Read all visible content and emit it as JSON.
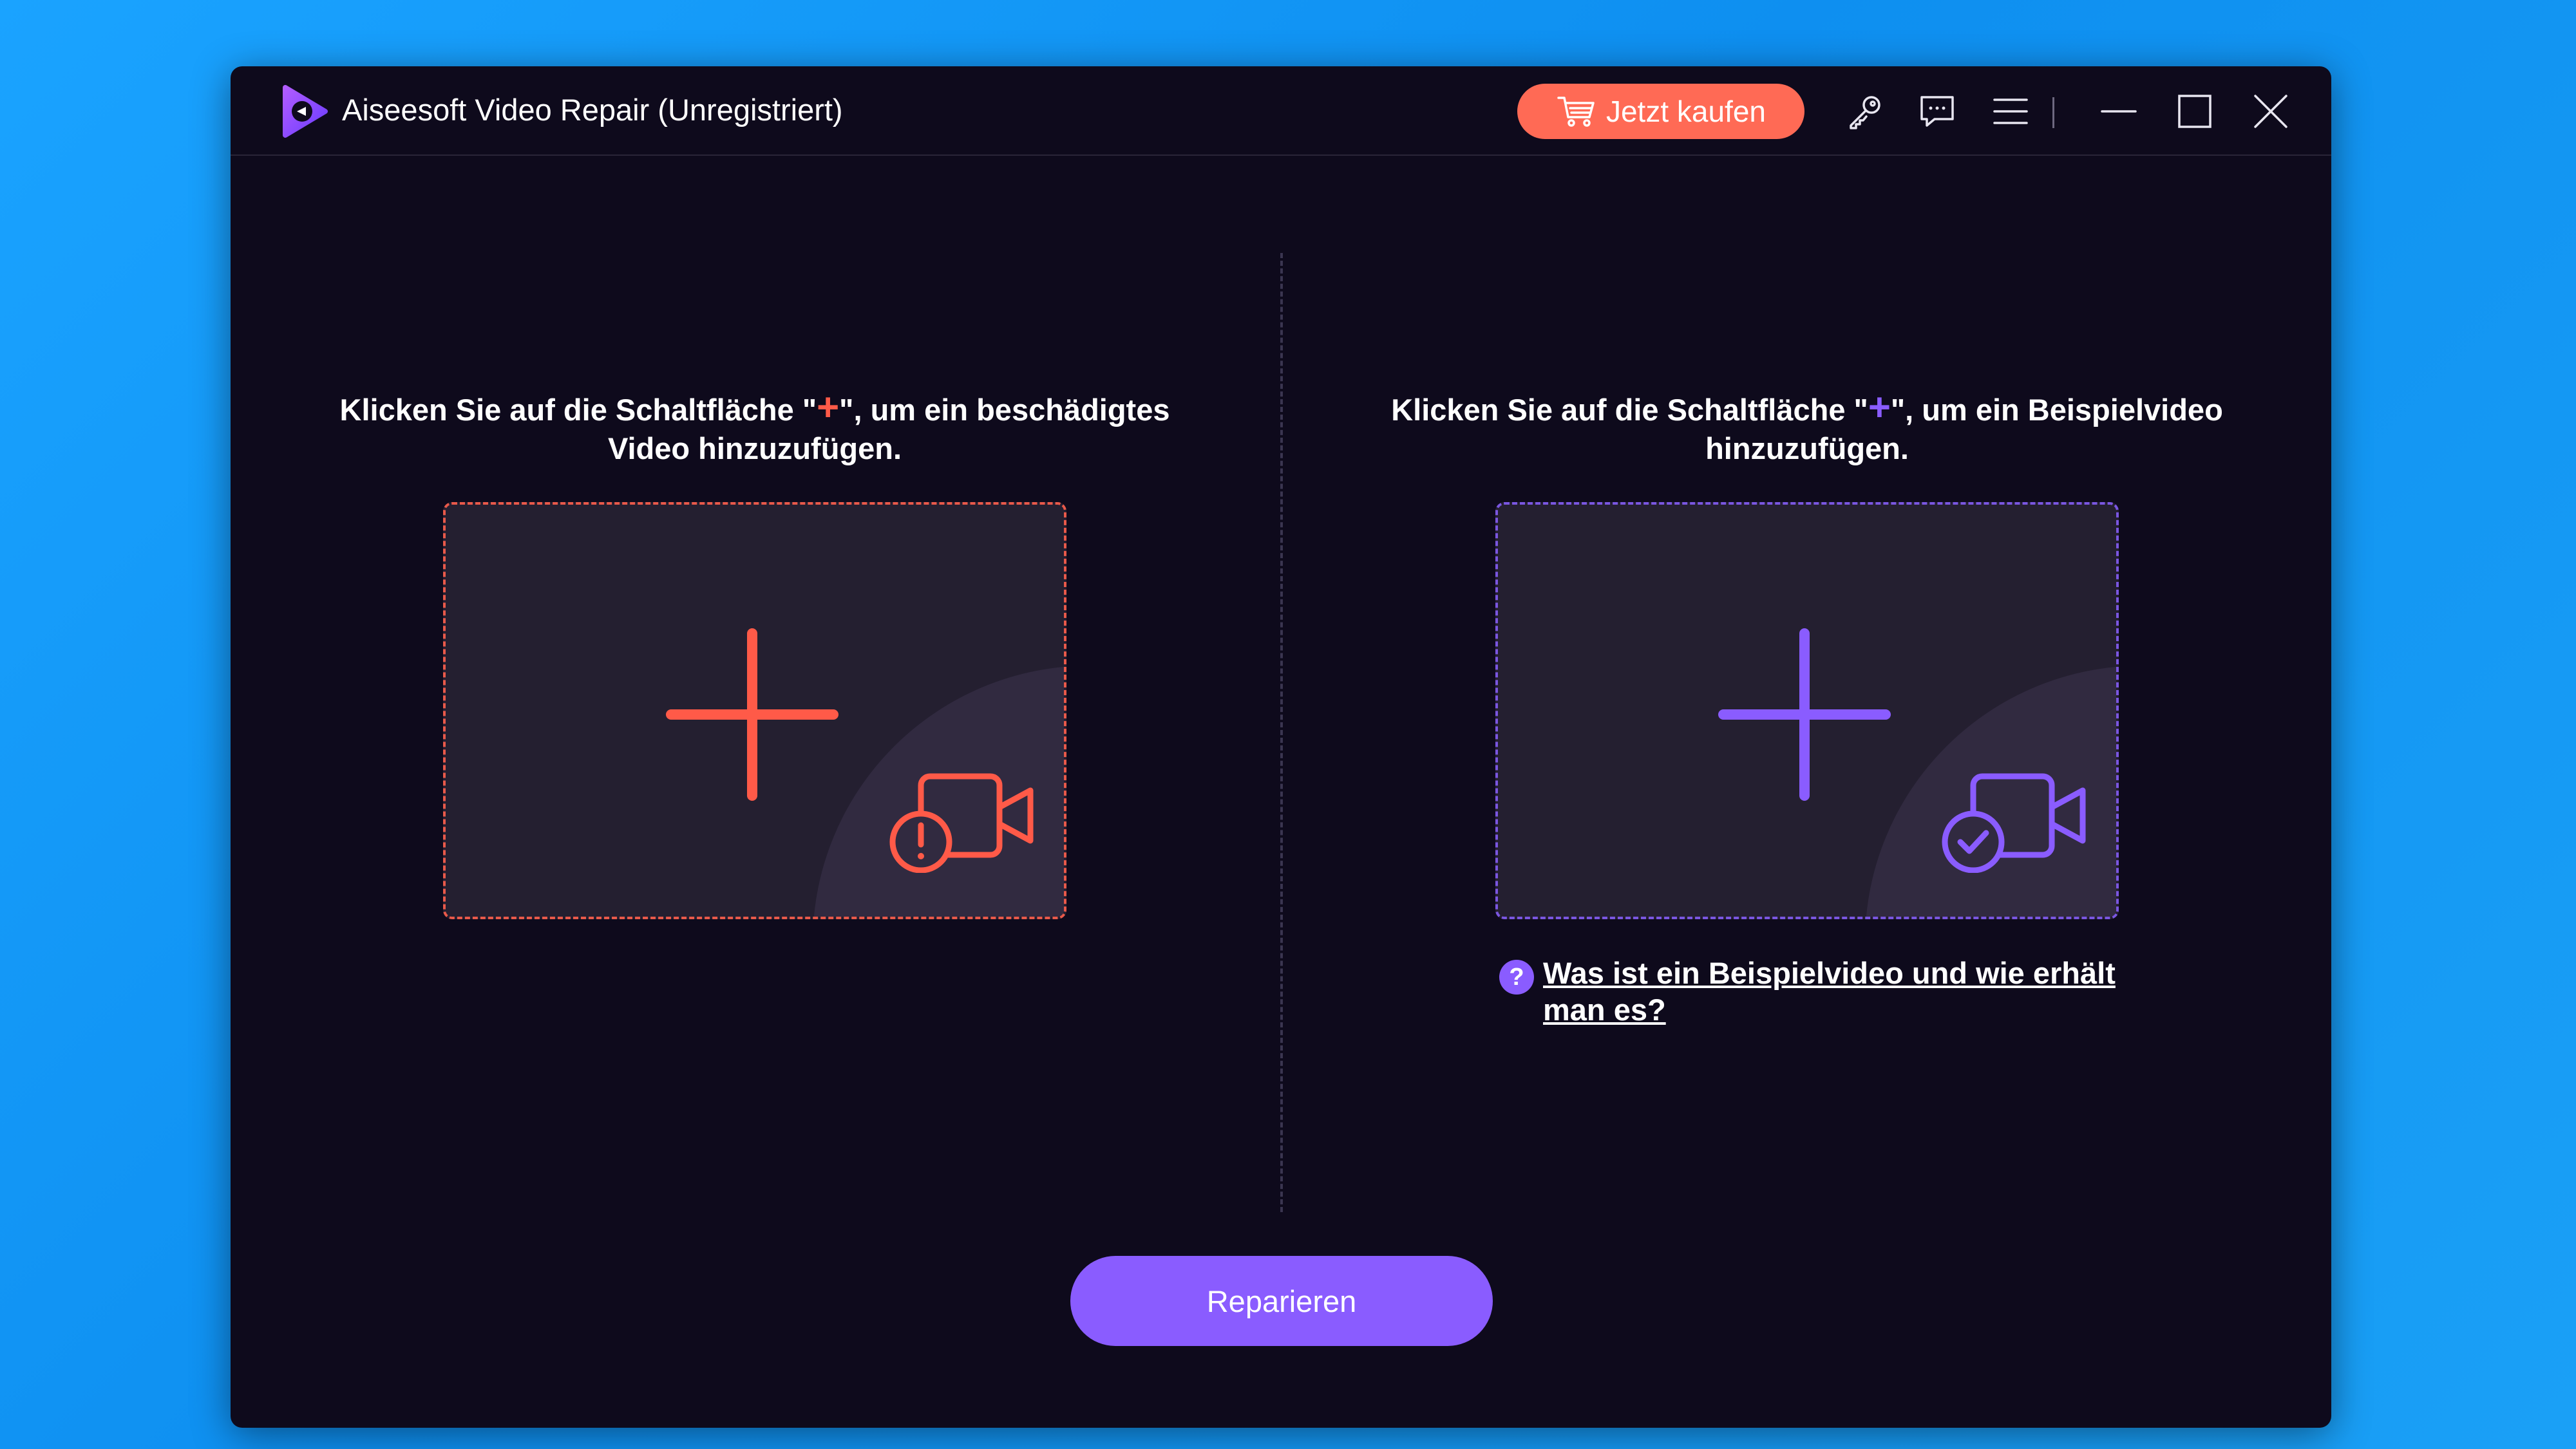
{
  "window": {
    "title": "Aiseesoft Video Repair (Unregistriert)"
  },
  "toolbar": {
    "buy_label": "Jetzt kaufen",
    "icons": [
      "cart-icon",
      "key-icon",
      "feedback-icon",
      "menu-icon",
      "minimize-icon",
      "maximize-icon",
      "close-icon"
    ]
  },
  "left_panel": {
    "instruction_part1": "Klicken Sie auf die Schaltfläche \"",
    "plus_glyph": "+",
    "instruction_part2": "\", um ein beschädigtes Video hinzuzufügen."
  },
  "right_panel": {
    "instruction_part1": "Klicken Sie auf die Schaltfläche \"",
    "plus_glyph": "+",
    "instruction_part2": "\", um ein Beispielvideo hinzuzufügen.",
    "help_icon_glyph": "?",
    "help_link": "Was ist ein Beispielvideo und wie erhält man es?"
  },
  "actions": {
    "repair_label": "Reparieren"
  },
  "colors": {
    "background": "#0e0a1c",
    "accent_red": "#ff5a48",
    "accent_purple": "#8a5cff",
    "buy_button": "#ff6a55"
  }
}
